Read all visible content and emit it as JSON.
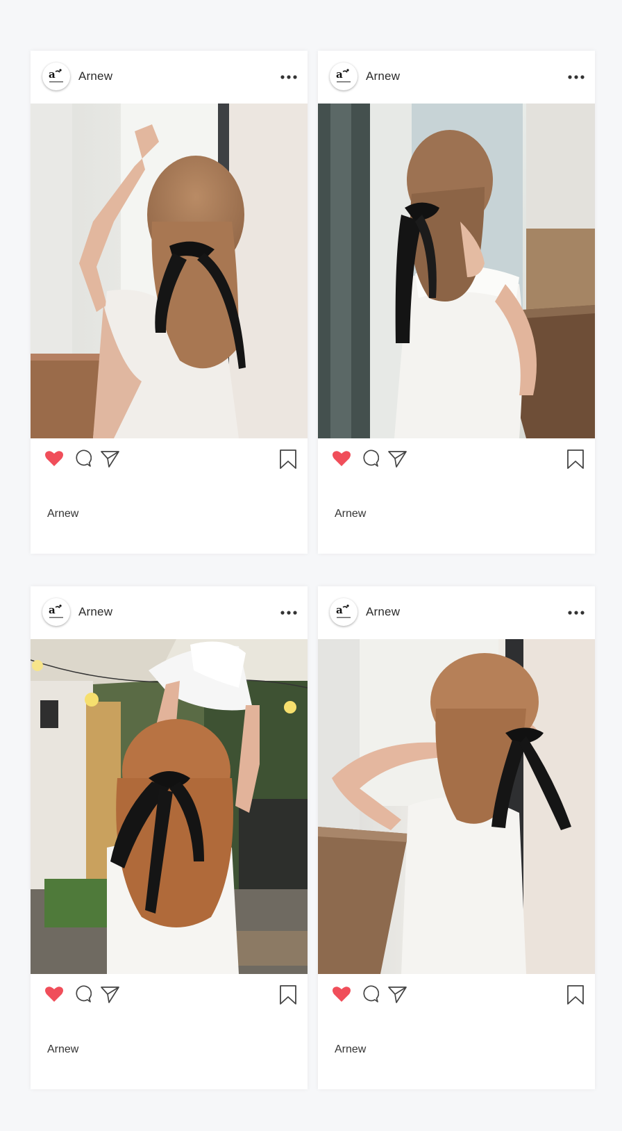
{
  "colors": {
    "background": "#f6f7f9",
    "card": "#ffffff",
    "heart": "#f04e5a",
    "icon_stroke": "#444444"
  },
  "posts": [
    {
      "username": "Arnew",
      "caption_user": "Arnew",
      "liked": true,
      "icons": [
        "more-icon",
        "heart-icon",
        "comment-icon",
        "share-icon",
        "bookmark-icon"
      ],
      "image_description": "Woman with light brown hair and black ribbon bow, arm raised, facing window"
    },
    {
      "username": "Arnew",
      "caption_user": "Arnew",
      "liked": true,
      "icons": [
        "more-icon",
        "heart-icon",
        "comment-icon",
        "share-icon",
        "bookmark-icon"
      ],
      "image_description": "Woman with black ribbon in ponytail leaning on table by window"
    },
    {
      "username": "Arnew",
      "caption_user": "Arnew",
      "liked": true,
      "icons": [
        "more-icon",
        "heart-icon",
        "comment-icon",
        "share-icon",
        "bookmark-icon"
      ],
      "image_description": "Woman holding white hat in garden with black ribbon in hair"
    },
    {
      "username": "Arnew",
      "caption_user": "Arnew",
      "liked": true,
      "icons": [
        "more-icon",
        "heart-icon",
        "comment-icon",
        "share-icon",
        "bookmark-icon"
      ],
      "image_description": "Woman tying black ribbon bow with both hands near window"
    }
  ]
}
